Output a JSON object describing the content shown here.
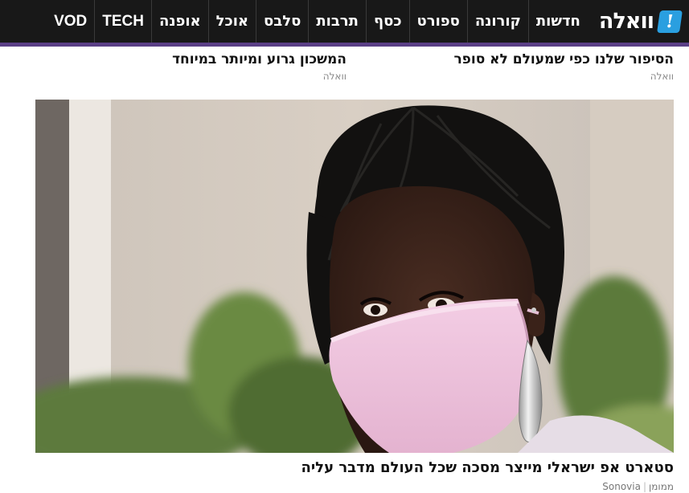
{
  "header": {
    "logo_text": "וואלה",
    "logo_mark": "!",
    "nav_items": [
      {
        "label": "חדשות",
        "latin": false
      },
      {
        "label": "קורונה",
        "latin": false
      },
      {
        "label": "ספורט",
        "latin": false
      },
      {
        "label": "כסף",
        "latin": false
      },
      {
        "label": "תרבות",
        "latin": false
      },
      {
        "label": "סלבס",
        "latin": false
      },
      {
        "label": "אוכל",
        "latin": false
      },
      {
        "label": "אופנה",
        "latin": false
      },
      {
        "label": "TECH",
        "latin": true
      },
      {
        "label": "VOD",
        "latin": true
      }
    ],
    "colors": {
      "bar": "#181818",
      "accent": "#5a3f86",
      "logo_badge": "#2a9fe0"
    }
  },
  "articles_top": [
    {
      "title": "הסיפור שלנו כפי שמעולם לא סופר",
      "source": "וואלה"
    },
    {
      "title": "המשכון גרוע ומיותר במיוחד",
      "source": "וואלה"
    }
  ],
  "hero": {
    "image_alt": "woman with braided hair wearing a pink face mask",
    "title": "סטארט אפ ישראלי מייצר מסכה שכל העולם מדבר עליה",
    "sponsor_label": "ממומן",
    "sponsor_name": "Sonovia"
  }
}
